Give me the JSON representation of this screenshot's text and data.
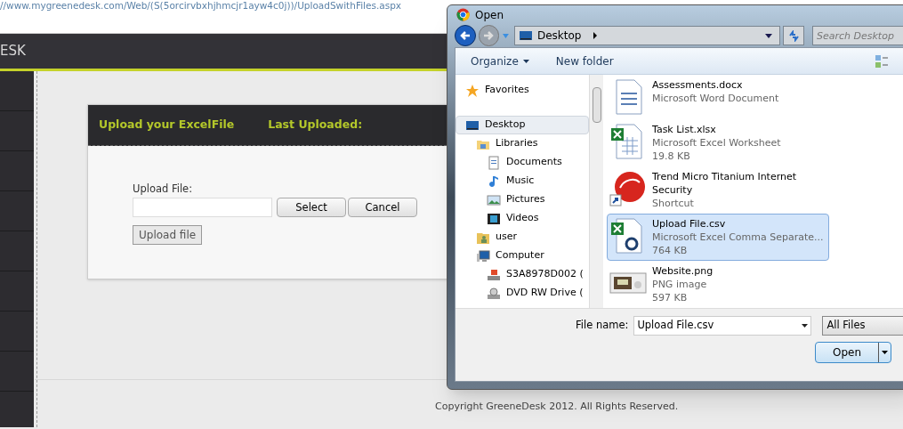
{
  "browser": {
    "url": "//www.mygreenedesk.com/Web/(S(5orcirvbxhjhmcjr1ayw4c0j))/UploadSwithFiles.aspx"
  },
  "header": {
    "brand": "ESK"
  },
  "card": {
    "tabs": [
      "Upload your ExcelFile",
      "Last Uploaded:"
    ],
    "label": "Upload File:",
    "buttons": [
      "Select",
      "Cancel"
    ],
    "upload": "Upload file"
  },
  "footer": "Copyright GreeneDesk 2012. All Rights Reserved.",
  "dialog": {
    "title": "Open",
    "location": "Desktop",
    "search_placeholder": "Search Desktop",
    "toolbar": [
      "Organize",
      "New folder"
    ],
    "nav": [
      {
        "label": "Favorites",
        "kind": "star",
        "selected": false
      },
      {
        "label": "Desktop",
        "kind": "desktop",
        "selected": true,
        "children": [
          {
            "label": "Libraries",
            "kind": "library",
            "selected": false,
            "children": [
              {
                "label": "Documents",
                "kind": "document",
                "selected": false
              },
              {
                "label": "Music",
                "kind": "music",
                "selected": false
              },
              {
                "label": "Pictures",
                "kind": "pictures",
                "selected": false
              },
              {
                "label": "Videos",
                "kind": "videos",
                "selected": false
              }
            ]
          },
          {
            "label": "user",
            "kind": "user",
            "selected": false
          },
          {
            "label": "Computer",
            "kind": "computer",
            "selected": false,
            "children": [
              {
                "label": "S3A8978D002 (",
                "kind": "drive",
                "selected": false
              },
              {
                "label": "DVD RW Drive (",
                "kind": "dvd",
                "selected": false
              }
            ]
          }
        ]
      }
    ],
    "files": [
      {
        "name": "Assessments.docx",
        "type": "Microsoft Word Document",
        "kind": "word",
        "selected": false
      },
      {
        "name": "Task List.xlsx",
        "type": "Microsoft Excel Worksheet",
        "size": "19.8 KB",
        "kind": "excel",
        "selected": false
      },
      {
        "name": "Trend Micro Titanium Internet Security",
        "type": "Shortcut",
        "kind": "shortcut",
        "selected": false
      },
      {
        "name": "Upload File.csv",
        "type": "Microsoft Excel Comma Separate...",
        "size": "764 KB",
        "kind": "csv",
        "selected": true
      },
      {
        "name": "Website.png",
        "type": "PNG image",
        "size": "597 KB",
        "kind": "image",
        "selected": false
      }
    ],
    "file_name_label": "File name:",
    "file_name": "Upload File.csv",
    "filter": "All Files",
    "open": "Open"
  }
}
